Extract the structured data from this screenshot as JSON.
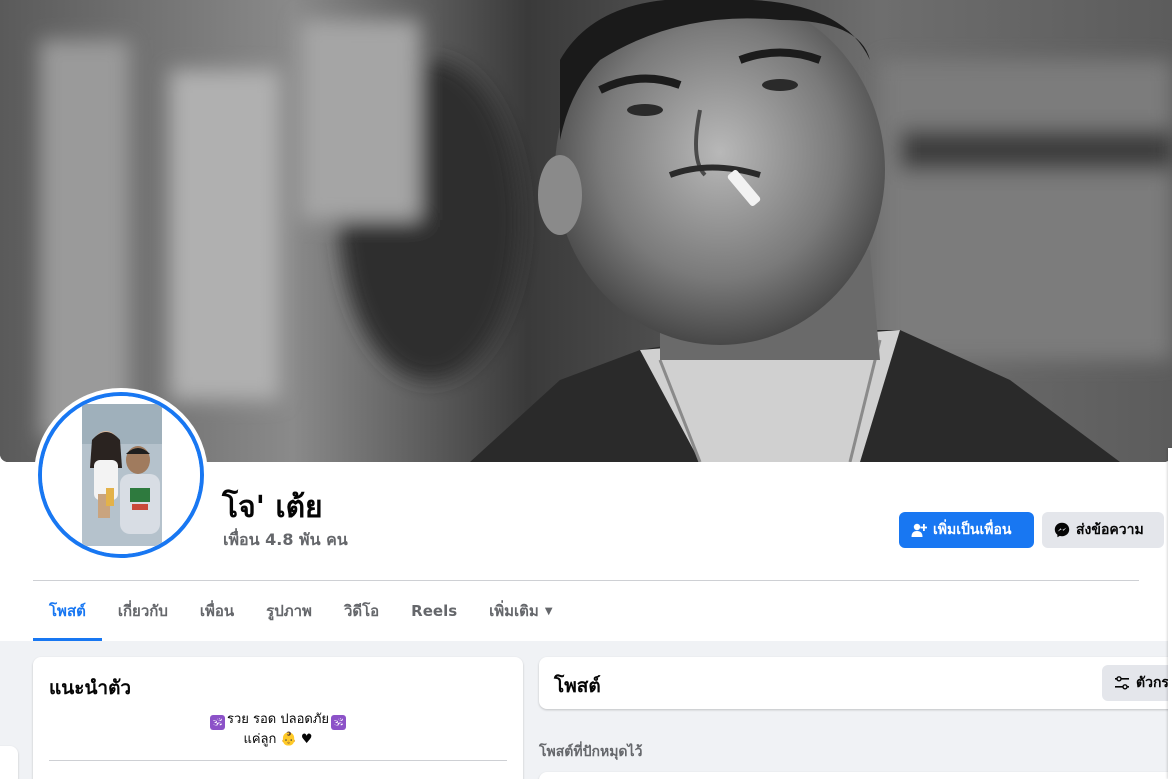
{
  "profile": {
    "name": "โจ' เต้ย",
    "friends_summary": "เพื่อน 4.8 พัน คน",
    "cover_photo_icon": "cover-photo",
    "avatar_icon": "profile-photo"
  },
  "actions": {
    "add_friend_label": "เพิ่มเป็นเพื่อน",
    "message_label": "ส่งข้อความ"
  },
  "tabs": [
    {
      "label": "โพสต์",
      "active": true
    },
    {
      "label": "เกี่ยวกับ",
      "active": false
    },
    {
      "label": "เพื่อน",
      "active": false
    },
    {
      "label": "รูปภาพ",
      "active": false
    },
    {
      "label": "วิดีโอ",
      "active": false
    },
    {
      "label": "Reels",
      "active": false
    },
    {
      "label": "เพิ่มเติม",
      "active": false,
      "dropdown": true
    }
  ],
  "intro": {
    "title": "แนะนำตัว",
    "bio_line1_text": "รวย รอด ปลอดภัย",
    "bio_line1_icon": "🕉",
    "bio_line2": "แค่ลูก 👶 ♥"
  },
  "posts": {
    "title": "โพสต์",
    "filter_label": "ตัวกร",
    "pinned_label": "โพสต์ที่ปักหมุดไว้"
  },
  "colors": {
    "accent": "#1877f2",
    "background": "#f0f2f5",
    "secondary_button": "#e4e6eb",
    "muted_text": "#65676b"
  }
}
